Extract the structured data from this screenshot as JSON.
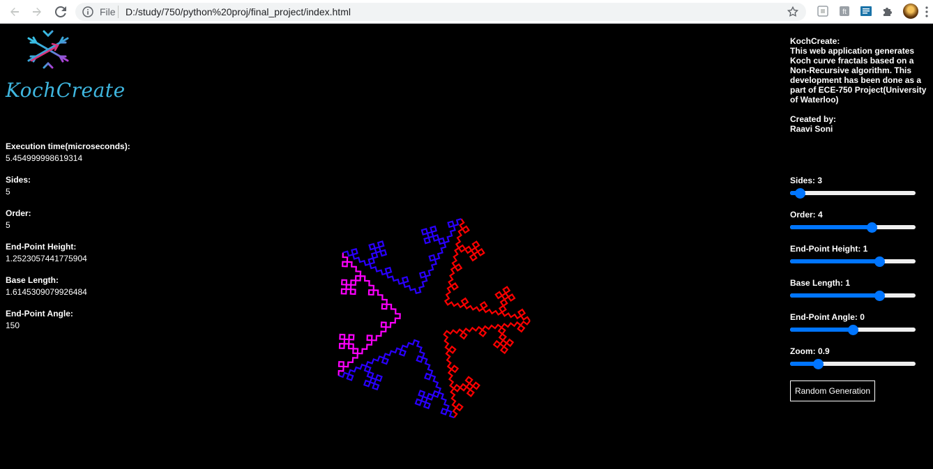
{
  "browser": {
    "url_scheme_label": "File",
    "url": "D:/study/750/python%20proj/final_project/index.html"
  },
  "app": {
    "logo_text": "KochCreate"
  },
  "stats": [
    {
      "label": "Execution time(microseconds):",
      "value": "5.454999998619314"
    },
    {
      "label": "Sides:",
      "value": "5"
    },
    {
      "label": "Order:",
      "value": "5"
    },
    {
      "label": "End-Point Height:",
      "value": "1.2523057441775904"
    },
    {
      "label": "Base Length:",
      "value": "1.6145309079926484"
    },
    {
      "label": "End-Point Angle:",
      "value": "150"
    }
  ],
  "info": {
    "title": "KochCreate:",
    "description": "This web application generates Koch curve fractals based on a Non-Recursive algorithm. This development has been done as a part of ECE-750 Project(University of Waterloo)",
    "created_by_label": "Created by:",
    "author": "Raavi Soni"
  },
  "controls": [
    {
      "label": "Sides: 3",
      "fraction": 0.04
    },
    {
      "label": "Order: 4",
      "fraction": 0.66
    },
    {
      "label": "End-Point Height: 1",
      "fraction": 0.73
    },
    {
      "label": "Base Length: 1",
      "fraction": 0.73
    },
    {
      "label": "End-Point Angle: 0",
      "fraction": 0.5
    },
    {
      "label": "Zoom: 0.9",
      "fraction": 0.2
    }
  ],
  "random_button": "Random Generation",
  "colors": {
    "slider_accent": "#0075ff",
    "fractal_start": "#ff0000",
    "fractal_mid": "#2a00ff",
    "fractal_end": "#ff00ff"
  }
}
